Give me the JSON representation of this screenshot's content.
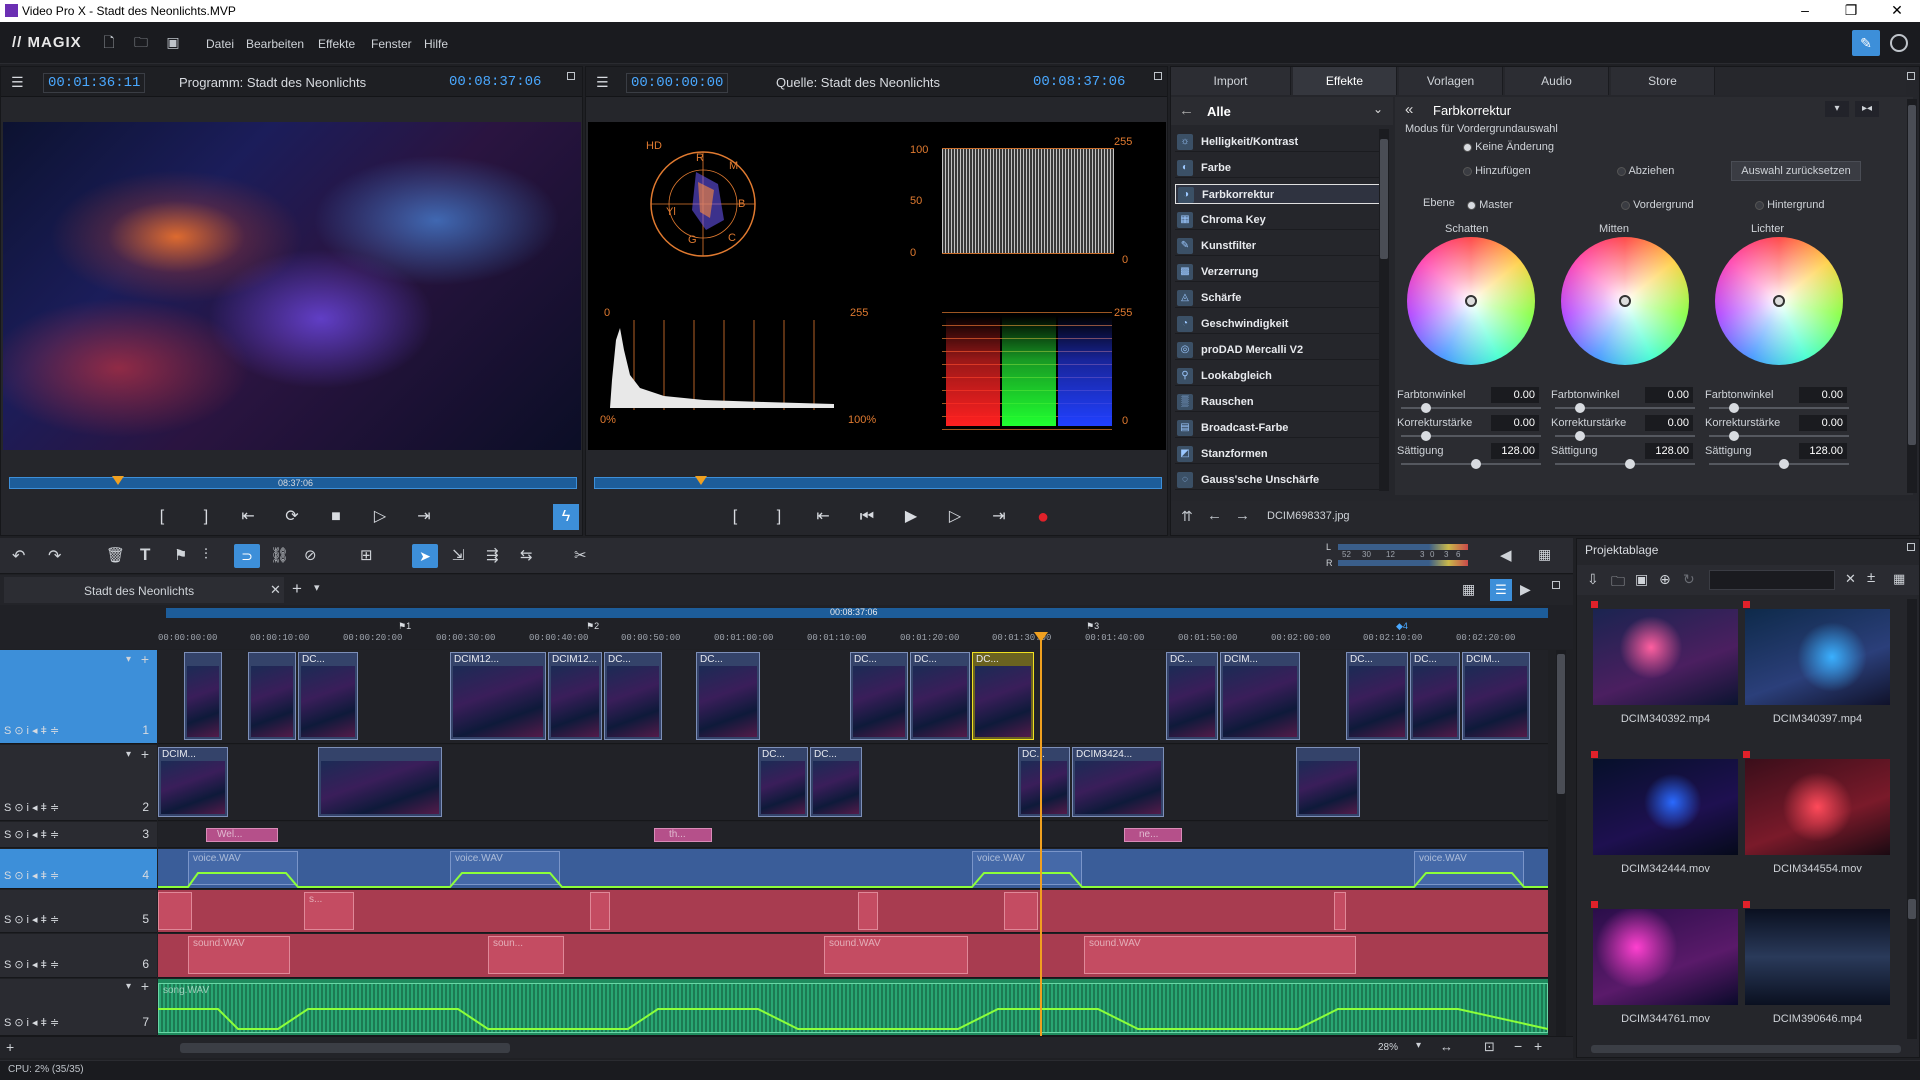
{
  "window": {
    "title": "Video Pro X - Stadt des Neonlichts.MVP",
    "controls": [
      "–",
      "❐",
      "✕"
    ]
  },
  "menubar": {
    "logo": "// MAGIX",
    "items": [
      "Datei",
      "Bearbeiten",
      "Effekte",
      "Fenster",
      "Hilfe"
    ]
  },
  "program_monitor": {
    "timecode_left": "00:01:36:11",
    "title": "Programm: Stadt des Neonlichts",
    "timecode_right": "00:08:37:06",
    "scrub_time": "08:37:06"
  },
  "source_monitor": {
    "timecode_left": "00:00:00:00",
    "title": "Quelle: Stadt des Neonlichts",
    "timecode_right": "00:08:37:06"
  },
  "scopes": {
    "vectorscope_label": "HD",
    "vectorscope_marks": [
      "R",
      "M",
      "B",
      "C",
      "G",
      "Yl"
    ],
    "waveform_labels": [
      "100",
      "50",
      "0",
      "255",
      "0"
    ],
    "histogram_labels": [
      "0",
      "255",
      "0%",
      "100%"
    ],
    "rgb_parade_labels": [
      "255",
      "0"
    ]
  },
  "media_tabs": [
    "Import",
    "Effekte",
    "Vorlagen",
    "Audio",
    "Store"
  ],
  "effects_list": {
    "category": "Alle",
    "items": [
      "Helligkeit/Kontrast",
      "Farbe",
      "Farbkorrektur",
      "Chroma Key",
      "Kunstfilter",
      "Verzerrung",
      "Schärfe",
      "Geschwindigkeit",
      "proDAD Mercalli V2",
      "Lookabgleich",
      "Rauschen",
      "Broadcast-Farbe",
      "Stanzformen",
      "Gauss'sche Unschärfe"
    ],
    "selected": "Farbkorrektur",
    "footer_file": "DCIM698337.jpg"
  },
  "color_correction": {
    "title": "Farbkorrektur",
    "mode_label": "Modus für Vordergrundauswahl",
    "mode_options": [
      "Keine Änderung",
      "Hinzufügen",
      "Abziehen"
    ],
    "reset_button": "Auswahl zurücksetzen",
    "layer_label": "Ebene",
    "layer_options": [
      "Master",
      "Vordergrund",
      "Hintergrund"
    ],
    "wheels": [
      {
        "name": "Schatten",
        "hue_label": "Farbtonwinkel",
        "hue": "0.00",
        "strength_label": "Korrekturstärke",
        "strength": "0.00",
        "sat_label": "Sättigung",
        "sat": "128.00"
      },
      {
        "name": "Mitten",
        "hue_label": "Farbtonwinkel",
        "hue": "0.00",
        "strength_label": "Korrekturstärke",
        "strength": "0.00",
        "sat_label": "Sättigung",
        "sat": "128.00"
      },
      {
        "name": "Lichter",
        "hue_label": "Farbtonwinkel",
        "hue": "0.00",
        "strength_label": "Korrekturstärke",
        "strength": "0.00",
        "sat_label": "Sättigung",
        "sat": "128.00"
      }
    ]
  },
  "timeline": {
    "tab_title": "Stadt des Neonlichts",
    "top_timecode": "00:08:37:06",
    "ruler": [
      "00:00:00:00",
      "00:00:10:00",
      "00:00:20:00",
      "00:00:30:00",
      "00:00:40:00",
      "00:00:50:00",
      "00:01:00:00",
      "00:01:10:00",
      "00:01:20:00",
      "00:01:30:00",
      "00:01:40:00",
      "00:01:50:00",
      "00:02:00:00",
      "00:02:10:00",
      "00:02:20:00"
    ],
    "markers": [
      "1",
      "2",
      "3",
      "4"
    ],
    "meter_labels": [
      "L",
      "R",
      "52",
      "30",
      "12",
      "3",
      "0",
      "3",
      "6"
    ],
    "track_icons": "S⊙i◂ǂ≑",
    "tracks": [
      "1",
      "2",
      "3",
      "4",
      "5",
      "6",
      "7"
    ],
    "track1_clips": [
      "DC...",
      "DCIM12...",
      "DCIM12...",
      "DC...",
      "DC...",
      "DC...",
      "DC...",
      "DC...",
      "DC...",
      "DCIM...",
      "DC...",
      "DC...",
      "DCIM..."
    ],
    "track2_clips": [
      "DCIM...",
      "DC...",
      "DC...",
      "DC...",
      "DCIM3424..."
    ],
    "track3_clips": [
      "Wel...",
      "th...",
      "ne..."
    ],
    "track4_clips": [
      "voice.WAV",
      "voice.WAV",
      "voice.WAV",
      "voice.WAV"
    ],
    "track5_clips": [
      "s..."
    ],
    "track6_clips": [
      "sound.WAV",
      "soun...",
      "sound.WAV",
      "sound.WAV"
    ],
    "track7_clips": [
      "song.WAV"
    ],
    "zoom": "28%"
  },
  "project_bin": {
    "title": "Projektablage",
    "items": [
      "DCIM340392.mp4",
      "DCIM340397.mp4",
      "DCIM342444.mov",
      "DCIM344554.mov",
      "DCIM344761.mov",
      "DCIM390646.mp4"
    ]
  },
  "status": {
    "cpu": "CPU: 2% (35/35)"
  },
  "colors": {
    "accent": "#4aa8ff",
    "selected_track": "#3d8fd9",
    "record": "#e0212a",
    "audio_blue": "#4569a8",
    "audio_red": "#c44c62",
    "audio_green": "#29a673",
    "envelope": "#8cff3a",
    "playhead": "#f0a020"
  }
}
